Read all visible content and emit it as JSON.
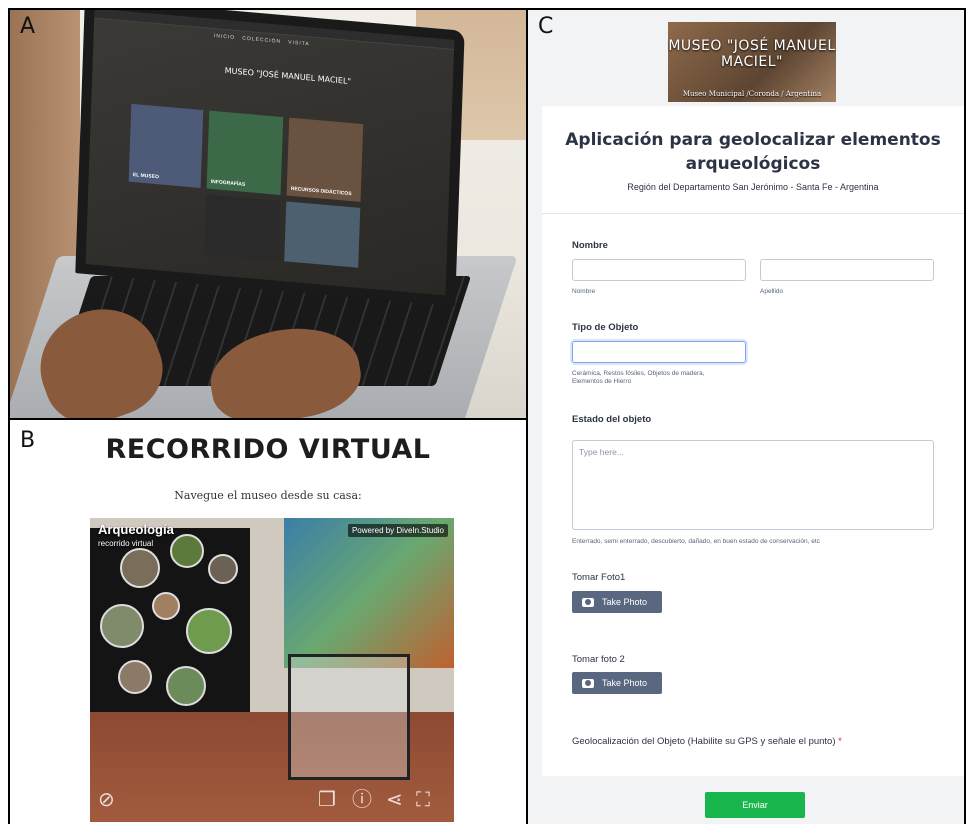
{
  "panels": {
    "a": {
      "letter": "A",
      "laptop_site": {
        "title": "MUSEO \"JOSÉ MANUEL MACIEL\"",
        "tiles": [
          "EL MUSEO",
          "INFOGRAFÍAS",
          "RECURSOS DIDÁCTICOS"
        ]
      }
    },
    "b": {
      "letter": "B",
      "title": "RECORRIDO VIRTUAL",
      "subtitle": "Navegue el museo desde su casa:",
      "tour": {
        "title": "Arqueología",
        "subtitle": "recorrido virtual",
        "powered": "Powered by DiveIn.Studio"
      }
    },
    "c": {
      "letter": "C",
      "hero": {
        "title": "MUSEO \"JOSÉ MANUEL MACIEL\"",
        "subtitle": "Museo Municipal /Coronda / Argentina"
      },
      "form": {
        "heading": "Aplicación para geolocalizar elementos arqueológicos",
        "region": "Región del Departamento San Jerónimo - Santa Fe - Argentina",
        "nombre_label": "Nombre",
        "first_name_help": "Nombre",
        "last_name_help": "Apellido",
        "tipo_label": "Tipo de Objeto",
        "tipo_help": "Cerámica, Restos fósiles, Objetos de madera, Elementos de Hierro",
        "estado_label": "Estado del objeto",
        "estado_placeholder": "Type here...",
        "estado_help": "Enterrado, semi enterrado, descubierto, dañado, en buen estado de conservación, etc",
        "foto1_label": "Tomar Foto1",
        "foto2_label": "Tomar foto 2",
        "take_photo": "Take Photo",
        "geo_label": "Geolocalización del Objeto (Habilite su GPS y señale el punto)",
        "required_mark": "*",
        "submit": "Enviar"
      }
    }
  },
  "colors": {
    "submit_green": "#18b54c",
    "photo_button": "#5a6780",
    "required_red": "#d12b2b"
  }
}
